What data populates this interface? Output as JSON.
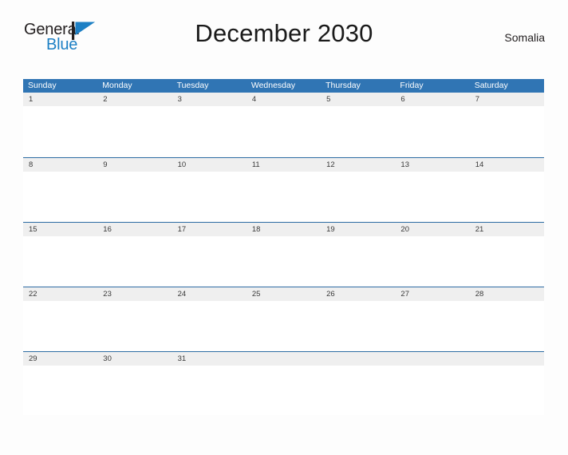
{
  "brand": {
    "word_one": "General",
    "word_two": "Blue",
    "flag_color": "#1c7fc4",
    "pole_color": "#231f20"
  },
  "header": {
    "title": "December 2030",
    "country": "Somalia"
  },
  "colors": {
    "header_blue": "#3075b4",
    "row_divider_blue": "#2e6da4",
    "date_band_gray": "#efefef",
    "page_background": "#fdfdfd"
  },
  "calendar": {
    "month": "December",
    "year": "2030",
    "weekdays": [
      {
        "label": "Sunday"
      },
      {
        "label": "Monday"
      },
      {
        "label": "Tuesday"
      },
      {
        "label": "Wednesday"
      },
      {
        "label": "Thursday"
      },
      {
        "label": "Friday"
      },
      {
        "label": "Saturday"
      }
    ],
    "weeks": [
      {
        "days": [
          {
            "date": "1"
          },
          {
            "date": "2"
          },
          {
            "date": "3"
          },
          {
            "date": "4"
          },
          {
            "date": "5"
          },
          {
            "date": "6"
          },
          {
            "date": "7"
          }
        ]
      },
      {
        "days": [
          {
            "date": "8"
          },
          {
            "date": "9"
          },
          {
            "date": "10"
          },
          {
            "date": "11"
          },
          {
            "date": "12"
          },
          {
            "date": "13"
          },
          {
            "date": "14"
          }
        ]
      },
      {
        "days": [
          {
            "date": "15"
          },
          {
            "date": "16"
          },
          {
            "date": "17"
          },
          {
            "date": "18"
          },
          {
            "date": "19"
          },
          {
            "date": "20"
          },
          {
            "date": "21"
          }
        ]
      },
      {
        "days": [
          {
            "date": "22"
          },
          {
            "date": "23"
          },
          {
            "date": "24"
          },
          {
            "date": "25"
          },
          {
            "date": "26"
          },
          {
            "date": "27"
          },
          {
            "date": "28"
          }
        ]
      },
      {
        "days": [
          {
            "date": "29"
          },
          {
            "date": "30"
          },
          {
            "date": "31"
          },
          {
            "date": ""
          },
          {
            "date": ""
          },
          {
            "date": ""
          },
          {
            "date": ""
          }
        ]
      }
    ]
  }
}
